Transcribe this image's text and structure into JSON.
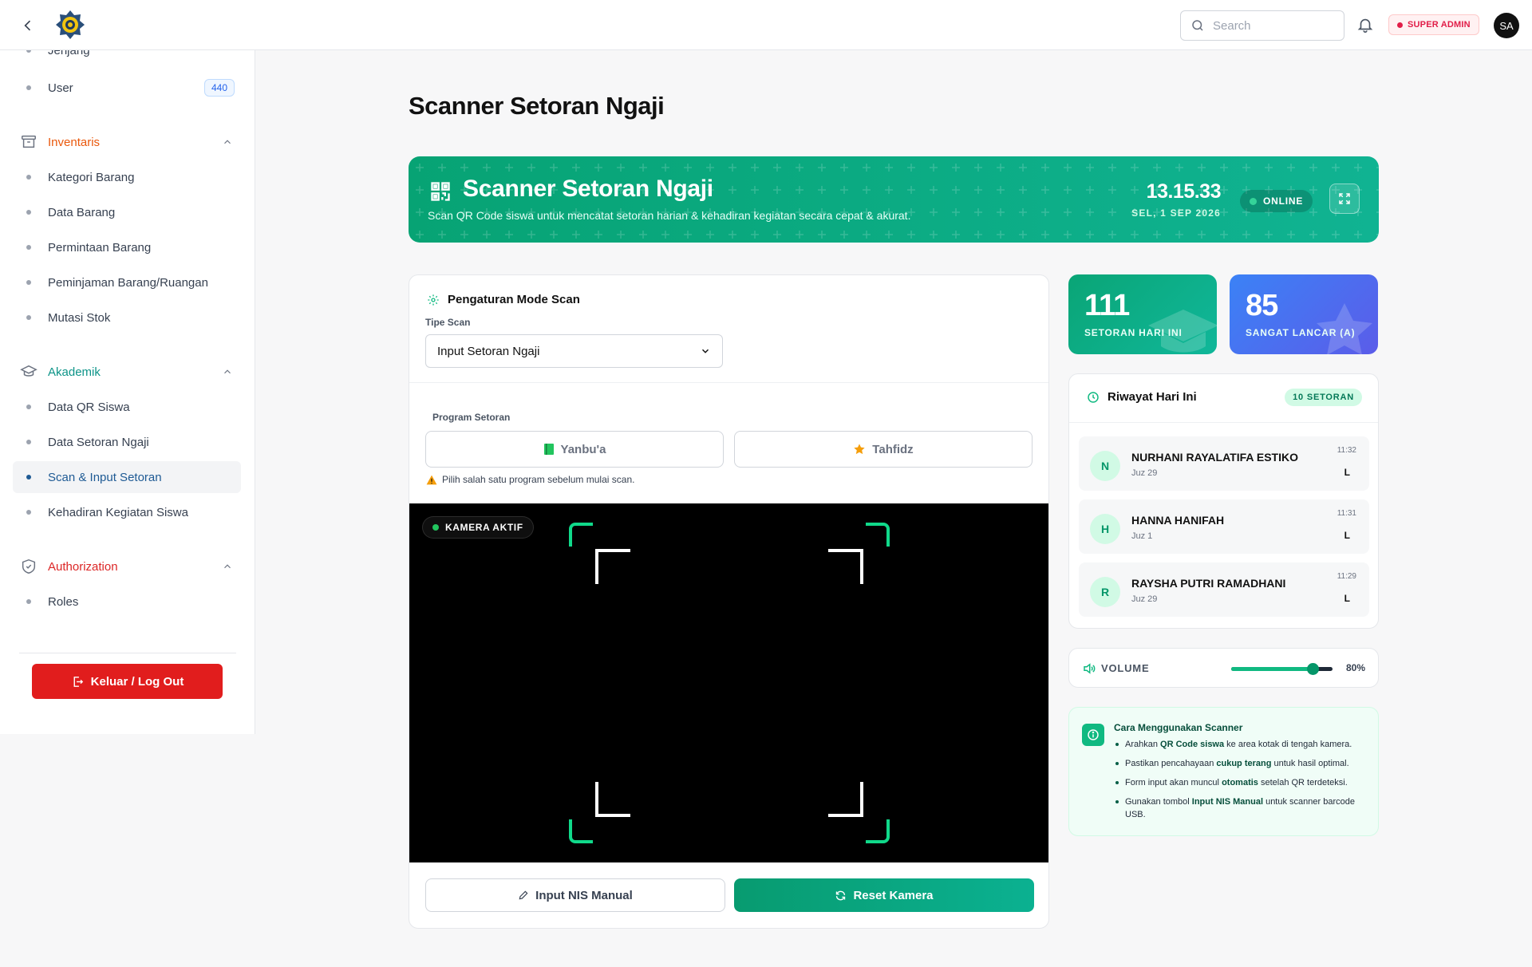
{
  "header": {
    "search_placeholder": "Search",
    "role_badge": "SUPER ADMIN",
    "avatar_initials": "SA"
  },
  "sidebar": {
    "items_top": [
      {
        "label": "Jenjang"
      },
      {
        "label": "User",
        "count": "440"
      }
    ],
    "inventaris": {
      "label": "Inventaris",
      "items": [
        "Kategori Barang",
        "Data Barang",
        "Permintaan Barang",
        "Peminjaman Barang/Ruangan",
        "Mutasi Stok"
      ]
    },
    "akademik": {
      "label": "Akademik",
      "items": [
        "Data QR Siswa",
        "Data Setoran Ngaji",
        "Scan & Input Setoran",
        "Kehadiran Kegiatan Siswa"
      ],
      "active_item": "Scan & Input Setoran"
    },
    "authorization": {
      "label": "Authorization",
      "items": [
        "Roles"
      ]
    },
    "logout_label": "Keluar / Log Out"
  },
  "page": {
    "title": "Scanner Setoran Ngaji"
  },
  "hero": {
    "title": "Scanner Setoran Ngaji",
    "subtitle": "Scan QR Code siswa untuk mencatat setoran harian & kehadiran kegiatan secara cepat & akurat.",
    "clock": "13.15.33",
    "date": "SEL, 1 SEP 2026",
    "status": "ONLINE"
  },
  "scan_settings": {
    "heading": "Pengaturan Mode Scan",
    "type_label": "Tipe Scan",
    "type_value": "Input Setoran Ngaji",
    "program_label": "Program Setoran",
    "programs": [
      {
        "label": "Yanbu'a",
        "icon": "book-icon"
      },
      {
        "label": "Tahfidz",
        "icon": "star-icon"
      }
    ],
    "warning": "Pilih salah satu program sebelum mulai scan."
  },
  "camera": {
    "badge": "KAMERA AKTIF"
  },
  "actions": {
    "manual_label": "Input NIS Manual",
    "reset_label": "Reset Kamera"
  },
  "stats": [
    {
      "value": "111",
      "label": "SETORAN HARI INI"
    },
    {
      "value": "85",
      "label": "SANGAT LANCAR (A)"
    }
  ],
  "history": {
    "title": "Riwayat Hari Ini",
    "badge": "10 SETORAN",
    "rows": [
      {
        "initial": "N",
        "name": "NURHANI RAYALATIFA ESTIKO",
        "juz": "Juz 29",
        "time": "11:32",
        "grade": "L"
      },
      {
        "initial": "H",
        "name": "HANNA HANIFAH",
        "juz": "Juz 1",
        "time": "11:31",
        "grade": "L"
      },
      {
        "initial": "R",
        "name": "RAYSHA PUTRI RAMADHANI",
        "juz": "Juz 29",
        "time": "11:29",
        "grade": "L"
      }
    ]
  },
  "volume": {
    "label": "VOLUME",
    "value_text": "80%",
    "level": 0.8
  },
  "howto": {
    "title": "Cara Menggunakan Scanner",
    "steps": [
      {
        "pre": "Arahkan ",
        "bold": "QR Code siswa",
        "post": " ke area kotak di tengah kamera."
      },
      {
        "pre": "Pastikan pencahayaan ",
        "bold": "cukup terang",
        "post": " untuk hasil optimal."
      },
      {
        "pre": "Form input akan muncul ",
        "bold": "otomatis",
        "post": " setelah QR terdeteksi."
      },
      {
        "pre": "Gunakan tombol ",
        "bold": "Input NIS Manual",
        "post": " untuk scanner barcode USB."
      }
    ]
  },
  "colors": {
    "accent_green": "#10b981",
    "accent_blue": "#3b82f6",
    "danger": "#e11d1d",
    "inventaris": "#ea580c",
    "akademik": "#0d9488",
    "authorization": "#dc2626"
  }
}
